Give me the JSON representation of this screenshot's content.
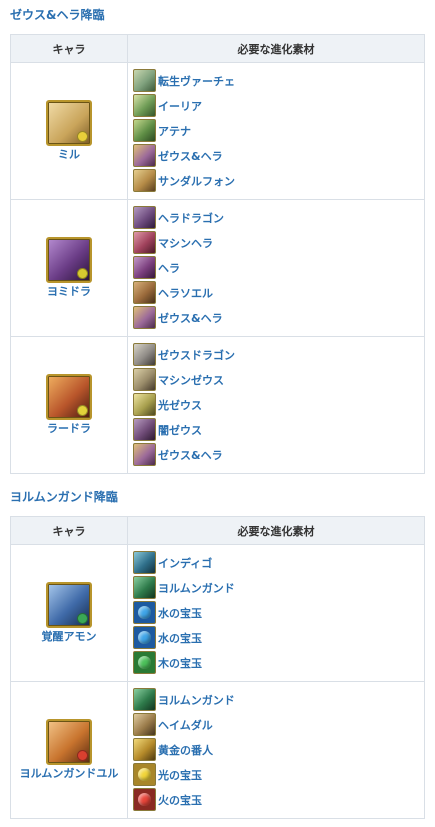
{
  "sections": [
    {
      "title": "ゼウス&ヘラ降臨",
      "header": {
        "chara": "キャラ",
        "materials": "必要な進化素材"
      },
      "rows": [
        {
          "chara": {
            "name": "ミル",
            "icon": "mil-portrait-icon",
            "color": "#c9a45a",
            "orb": "#e8cf3a"
          },
          "materials": [
            {
              "name": "転生ヴァーチェ",
              "icon": "virtue-icon",
              "color": "#7fa17d"
            },
            {
              "name": "イーリア",
              "icon": "iria-icon",
              "color": "#6f9c56"
            },
            {
              "name": "アテナ",
              "icon": "athena-icon",
              "color": "#5f8e46"
            },
            {
              "name": "ゼウス&ヘラ",
              "icon": "zeus-hera-icon",
              "color": "#9c6a9a"
            },
            {
              "name": "サンダルフォン",
              "icon": "sandalphon-icon",
              "color": "#b58b47"
            }
          ]
        },
        {
          "chara": {
            "name": "ヨミドラ",
            "icon": "yomidra-portrait-icon",
            "color": "#6a3c86",
            "orb": "#d8c92f"
          },
          "materials": [
            {
              "name": "ヘラドラゴン",
              "icon": "hera-dragon-icon",
              "color": "#6d4b7e"
            },
            {
              "name": "マシンヘラ",
              "icon": "machine-hera-icon",
              "color": "#a0425c"
            },
            {
              "name": "ヘラ",
              "icon": "hera-icon",
              "color": "#7b3f7e"
            },
            {
              "name": "ヘラソエル",
              "icon": "hera-soel-icon",
              "color": "#9a6a3b"
            },
            {
              "name": "ゼウス&ヘラ",
              "icon": "zeus-hera-icon",
              "color": "#9c6a9a"
            }
          ]
        },
        {
          "chara": {
            "name": "ラードラ",
            "icon": "radra-portrait-icon",
            "color": "#b9562b",
            "orb": "#e2d23a"
          },
          "materials": [
            {
              "name": "ゼウスドラゴン",
              "icon": "zeus-dragon-icon",
              "color": "#8f8b86"
            },
            {
              "name": "マシンゼウス",
              "icon": "machine-zeus-icon",
              "color": "#9a8c6a"
            },
            {
              "name": "光ゼウス",
              "icon": "light-zeus-icon",
              "color": "#a8a04e"
            },
            {
              "name": "闇ゼウス",
              "icon": "dark-zeus-icon",
              "color": "#6f4b77"
            },
            {
              "name": "ゼウス&ヘラ",
              "icon": "zeus-hera-icon",
              "color": "#9c6a9a"
            }
          ]
        }
      ]
    },
    {
      "title": "ヨルムンガンド降臨",
      "header": {
        "chara": "キャラ",
        "materials": "必要な進化素材"
      },
      "rows": [
        {
          "chara": {
            "name": "覚醒アモン",
            "icon": "awakened-amon-portrait-icon",
            "color": "#3f6aa8",
            "orb": "#3aa856"
          },
          "materials": [
            {
              "name": "インディゴ",
              "icon": "indigo-icon",
              "color": "#2f6f8a"
            },
            {
              "name": "ヨルムンガンド",
              "icon": "jormungandr-icon",
              "color": "#2e7a4a"
            },
            {
              "name": "水の宝玉",
              "icon": "water-jewel-icon",
              "color": "#1d5aa0",
              "gem": "#3fa5e8"
            },
            {
              "name": "水の宝玉",
              "icon": "water-jewel-icon",
              "color": "#1d5aa0",
              "gem": "#3fa5e8"
            },
            {
              "name": "木の宝玉",
              "icon": "wood-jewel-icon",
              "color": "#2a7a34",
              "gem": "#4cc15a"
            }
          ]
        },
        {
          "chara": {
            "name": "ヨルムンガンドユル",
            "icon": "jormungandr-yul-portrait-icon",
            "color": "#c8742e",
            "orb": "#d9402f"
          },
          "materials": [
            {
              "name": "ヨルムンガンド",
              "icon": "jormungandr-icon",
              "color": "#2e7a4a"
            },
            {
              "name": "ヘイムダル",
              "icon": "heimdall-icon",
              "color": "#9a7b4a"
            },
            {
              "name": "黄金の番人",
              "icon": "golden-guardian-icon",
              "color": "#b58a2a"
            },
            {
              "name": "光の宝玉",
              "icon": "light-jewel-icon",
              "color": "#a8862a",
              "gem": "#f2d53a"
            },
            {
              "name": "火の宝玉",
              "icon": "fire-jewel-icon",
              "color": "#8a2a22",
              "gem": "#e8453a"
            }
          ]
        }
      ]
    }
  ]
}
